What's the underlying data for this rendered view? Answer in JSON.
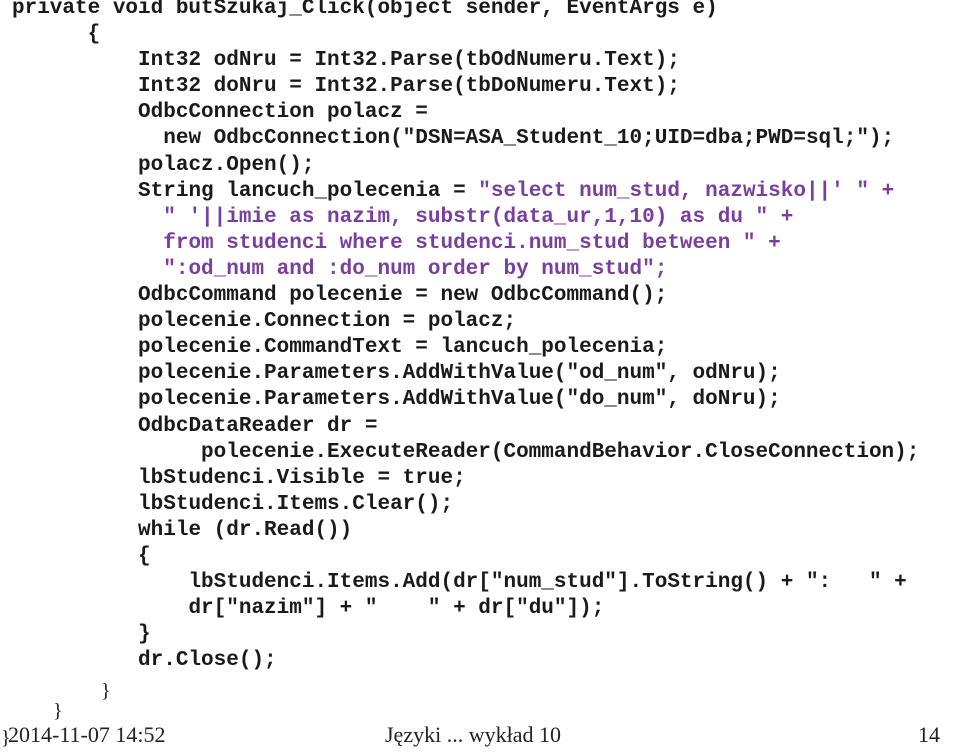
{
  "code": {
    "lines": [
      {
        "indent": "",
        "parts": [
          {
            "t": "private void butSzukaj_Click(object sender, EventArgs e)",
            "s": false
          }
        ]
      },
      {
        "indent": "      ",
        "parts": [
          {
            "t": "{",
            "s": false
          }
        ]
      },
      {
        "indent": "          ",
        "parts": [
          {
            "t": "Int32 odNru = Int32.Parse(tbOdNumeru.Text);",
            "s": false
          }
        ]
      },
      {
        "indent": "          ",
        "parts": [
          {
            "t": "Int32 doNru = Int32.Parse(tbDoNumeru.Text);",
            "s": false
          }
        ]
      },
      {
        "indent": "          ",
        "parts": [
          {
            "t": "OdbcConnection polacz =",
            "s": false
          }
        ]
      },
      {
        "indent": "            ",
        "parts": [
          {
            "t": "new OdbcConnection(\"DSN=ASA_Student_10;UID=dba;PWD=sql;\");",
            "s": false
          }
        ]
      },
      {
        "indent": "          ",
        "parts": [
          {
            "t": "polacz.Open();",
            "s": false
          }
        ]
      },
      {
        "indent": "          ",
        "parts": [
          {
            "t": "String lancuch_polecenia = ",
            "s": false
          },
          {
            "t": "\"select num_stud, nazwisko||' \" +",
            "s": true
          }
        ]
      },
      {
        "indent": "            ",
        "parts": [
          {
            "t": "\" '||imie as nazim, substr(data_ur,1,10) as du \" +",
            "s": true
          }
        ]
      },
      {
        "indent": "            ",
        "parts": [
          {
            "t": "from studenci where studenci.num_stud between \" +",
            "s": true
          }
        ]
      },
      {
        "indent": "            ",
        "parts": [
          {
            "t": "\":od_num and :do_num order by num_stud\";",
            "s": true
          }
        ]
      },
      {
        "indent": "          ",
        "parts": [
          {
            "t": "OdbcCommand polecenie = new OdbcCommand();",
            "s": false
          }
        ]
      },
      {
        "indent": "          ",
        "parts": [
          {
            "t": "polecenie.Connection = polacz;",
            "s": false
          }
        ]
      },
      {
        "indent": "          ",
        "parts": [
          {
            "t": "polecenie.CommandText = lancuch_polecenia;",
            "s": false
          }
        ]
      },
      {
        "indent": "          ",
        "parts": [
          {
            "t": "polecenie.Parameters.AddWithValue(\"od_num\", odNru);",
            "s": false
          }
        ]
      },
      {
        "indent": "          ",
        "parts": [
          {
            "t": "polecenie.Parameters.AddWithValue(\"do_num\", doNru);",
            "s": false
          }
        ]
      },
      {
        "indent": "          ",
        "parts": [
          {
            "t": "OdbcDataReader dr =",
            "s": false
          }
        ]
      },
      {
        "indent": "               ",
        "parts": [
          {
            "t": "polecenie.ExecuteReader(CommandBehavior.CloseConnection);",
            "s": false
          }
        ]
      },
      {
        "indent": "          ",
        "parts": [
          {
            "t": "lbStudenci.Visible = true;",
            "s": false
          }
        ]
      },
      {
        "indent": "          ",
        "parts": [
          {
            "t": "lbStudenci.Items.Clear();",
            "s": false
          }
        ]
      },
      {
        "indent": "          ",
        "parts": [
          {
            "t": "while (dr.Read())",
            "s": false
          }
        ]
      },
      {
        "indent": "          ",
        "parts": [
          {
            "t": "{",
            "s": false
          }
        ]
      },
      {
        "indent": "              ",
        "parts": [
          {
            "t": "lbStudenci.Items.Add(dr[\"num_stud\"].ToString() + \":   \" +",
            "s": false
          }
        ]
      },
      {
        "indent": "              ",
        "parts": [
          {
            "t": "dr[\"nazim\"] + \"    \" + dr[\"du\"]);",
            "s": false
          }
        ]
      },
      {
        "indent": "          ",
        "parts": [
          {
            "t": "}",
            "s": false
          }
        ]
      },
      {
        "indent": "          ",
        "parts": [
          {
            "t": "dr.Close();",
            "s": false
          }
        ]
      }
    ]
  },
  "braces": {
    "inner": "}",
    "outer": "}",
    "root": "}"
  },
  "footer": {
    "date": "2014-11-07 14:52",
    "title": "Języki ... wykład 10",
    "page": "14"
  }
}
